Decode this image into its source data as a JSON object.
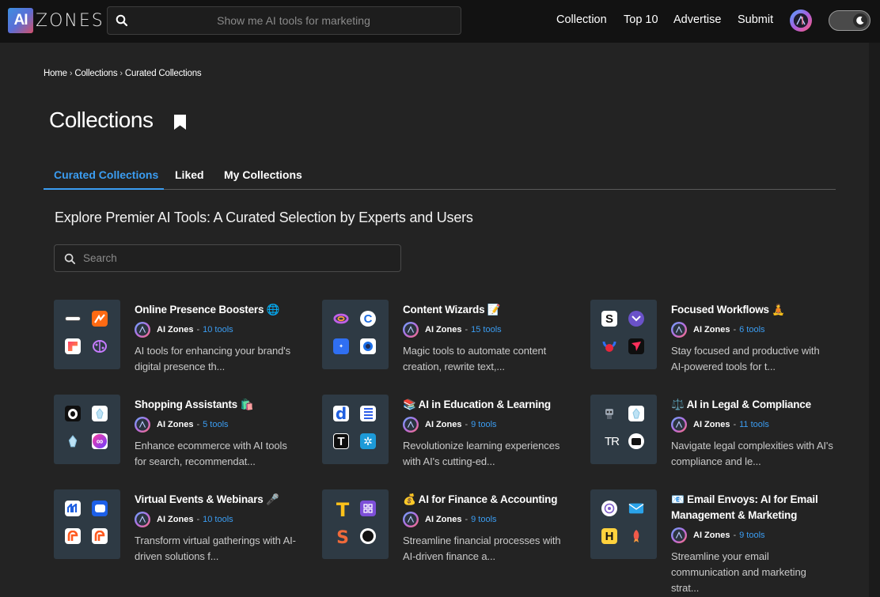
{
  "header": {
    "logo_badge": "AI",
    "logo_word": "ZONES",
    "search_placeholder": "Show me AI tools for marketing",
    "nav": [
      "Collection",
      "Top 10",
      "Advertise",
      "Submit"
    ]
  },
  "breadcrumb": [
    "Home",
    "Collections",
    "Curated Collections"
  ],
  "page": {
    "title": "Collections",
    "tabs": [
      "Curated Collections",
      "Liked",
      "My Collections"
    ],
    "active_tab": "Curated Collections",
    "subtitle": "Explore Premier AI Tools: A Curated Selection by Experts and Users",
    "search_placeholder": "Search"
  },
  "colors": {
    "accent": "#3b9df2",
    "background": "#232323",
    "topbar": "#121212",
    "card_thumb": "#2e3a44"
  },
  "collections": [
    {
      "title": "Online Presence Boosters 🌐",
      "author": "AI Zones",
      "count": "10 tools",
      "description": "AI tools for enhancing your brand's digital presence th..."
    },
    {
      "title": "Content Wizards 📝",
      "author": "AI Zones",
      "count": "15 tools",
      "description": "Magic tools to automate content creation, rewrite text,..."
    },
    {
      "title": "Focused Workflows 🧘",
      "author": "AI Zones",
      "count": "6 tools",
      "description": "Stay focused and productive with AI-powered tools for t..."
    },
    {
      "title": "Shopping Assistants 🛍️",
      "author": "AI Zones",
      "count": "5 tools",
      "description": "Enhance ecommerce with AI tools for search, recommendat..."
    },
    {
      "title": "📚 AI in Education & Learning",
      "author": "AI Zones",
      "count": "9 tools",
      "description": "Revolutionize learning experiences with AI's cutting-ed..."
    },
    {
      "title": "⚖️ AI in Legal & Compliance",
      "author": "AI Zones",
      "count": "11 tools",
      "description": "Navigate legal complexities with AI's compliance and le..."
    },
    {
      "title": "Virtual Events & Webinars 🎤",
      "author": "AI Zones",
      "count": "10 tools",
      "description": "Transform virtual gatherings with AI-driven solutions f..."
    },
    {
      "title": "💰 AI for Finance & Accounting",
      "author": "AI Zones",
      "count": "9 tools",
      "description": "Streamline financial processes with AI-driven finance a..."
    },
    {
      "title": "📧 Email Envoys: AI for Email Management & Marketing",
      "author": "AI Zones",
      "count": "9 tools",
      "description": "Streamline your email communication and marketing strat..."
    }
  ]
}
